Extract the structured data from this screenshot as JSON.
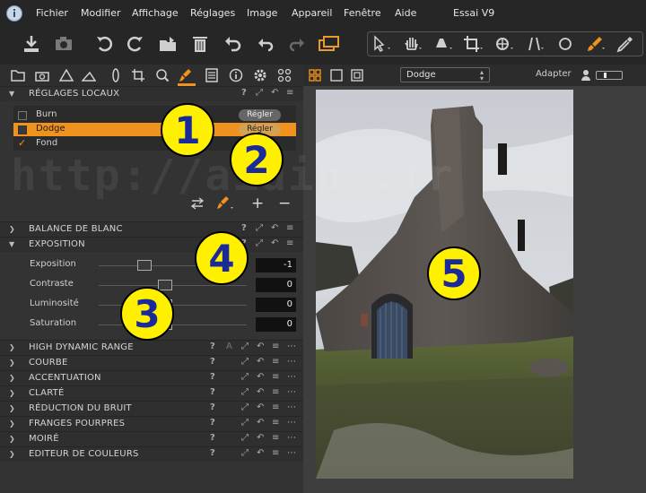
{
  "menu": {
    "items": [
      "Fichier",
      "Modifier",
      "Affichage",
      "Réglages",
      "Image",
      "Appareil",
      "Fenêtre",
      "Aide"
    ],
    "title": "Essai V9"
  },
  "toolbar": {
    "left_icons": [
      "import-icon",
      "camera-icon",
      "rotate-left-icon",
      "rotate-right-icon",
      "folder-export-icon",
      "trash-icon",
      "undo-icon",
      "undo-step-icon",
      "redo-icon",
      "process-icon"
    ],
    "right_icons": [
      "cursor-icon",
      "hand-icon",
      "loupe-icon",
      "crop-icon",
      "keystone-icon",
      "straighten-icon",
      "circle-icon",
      "brush-icon",
      "picker-icon"
    ]
  },
  "left_panel": {
    "tabs": [
      "library-icon",
      "camera-icon",
      "color-icon",
      "exposure-icon",
      "lens-icon",
      "crop-icon",
      "focus-icon",
      "local-adjust-icon",
      "metadata-icon",
      "info-icon",
      "settings-icon",
      "batch-icon"
    ],
    "local_adjustments": {
      "title": "RÉGLAGES LOCAUX",
      "layers": [
        {
          "name": "Burn",
          "button": "Régler",
          "checked": false,
          "selected": false
        },
        {
          "name": "Dodge",
          "button": "Régler",
          "checked": false,
          "selected": true
        },
        {
          "name": "Fond",
          "button": "",
          "checked": true,
          "selected": false
        }
      ]
    },
    "sections_top": [
      {
        "label": "BALANCE DE BLANC",
        "expanded": false
      }
    ],
    "exposure": {
      "label": "EXPOSITION",
      "sliders": [
        {
          "label": "Exposition",
          "value": "-1",
          "position": 0.31
        },
        {
          "label": "Contraste",
          "value": "0",
          "position": 0.45
        },
        {
          "label": "Luminosité",
          "value": "0",
          "position": 0.45
        },
        {
          "label": "Saturation",
          "value": "0",
          "position": 0.45
        }
      ]
    },
    "sections_bottom": [
      {
        "label": "HIGH DYNAMIC RANGE"
      },
      {
        "label": "COURBE"
      },
      {
        "label": "ACCENTUATION"
      },
      {
        "label": "CLARTÉ"
      },
      {
        "label": "RÉDUCTION DU BRUIT"
      },
      {
        "label": "FRANGES POURPRES"
      },
      {
        "label": "MOIRÉ"
      },
      {
        "label": "EDITEUR DE COULEURS"
      }
    ]
  },
  "viewer": {
    "layer_select": "Dodge",
    "fit_label": "Adapter"
  },
  "annotations": [
    "1",
    "2",
    "3",
    "4",
    "5"
  ],
  "watermark": "http://aidin     .fr",
  "colors": {
    "accent": "#f0921e",
    "badge": "#fff000",
    "badge_text": "#1a2a9a"
  }
}
